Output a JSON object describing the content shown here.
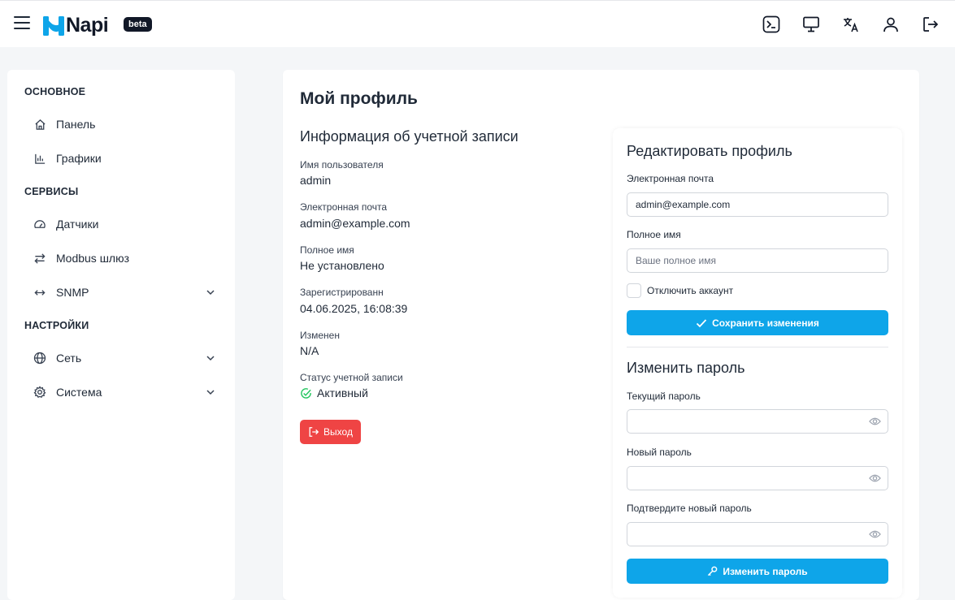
{
  "header": {
    "brand": "Napi",
    "badge": "beta",
    "icons": [
      "terminal-icon",
      "monitor-icon",
      "translate-icon",
      "user-icon",
      "logout-icon"
    ]
  },
  "sidebar": {
    "sections": [
      {
        "title": "ОСНОВНОЕ"
      },
      {
        "title": "СЕРВИСЫ"
      },
      {
        "title": "НАСТРОЙКИ"
      }
    ],
    "items": [
      {
        "label": "Панель",
        "icon": "home-icon"
      },
      {
        "label": "Графики",
        "icon": "bar-chart-icon"
      },
      {
        "label": "Датчики",
        "icon": "gauge-icon"
      },
      {
        "label": "Modbus шлюз",
        "icon": "arrows-exchange-icon"
      },
      {
        "label": "SNMP",
        "icon": "arrows-horizontal-icon"
      },
      {
        "label": "Сеть",
        "icon": "globe-icon"
      },
      {
        "label": "Система",
        "icon": "gear-icon"
      }
    ]
  },
  "main": {
    "title": "Мой профиль",
    "account_info": {
      "title": "Информация об учетной записи",
      "fields": [
        {
          "label": "Имя пользователя",
          "value": "admin"
        },
        {
          "label": "Электронная почта",
          "value": "admin@example.com"
        },
        {
          "label": "Полное имя",
          "value": "Не установлено"
        },
        {
          "label": "Зарегистрированн",
          "value": "04.06.2025, 16:08:39"
        },
        {
          "label": "Изменен",
          "value": "N/A"
        },
        {
          "label": "Статус учетной записи",
          "value": "Активный"
        }
      ],
      "logout_label": "Выход"
    },
    "edit_profile": {
      "title": "Редактировать профиль",
      "email_label": "Электронная почта",
      "email_value": "admin@example.com",
      "fullname_label": "Полное имя",
      "fullname_placeholder": "Ваше полное имя",
      "disable_label": "Отключить аккаунт",
      "save_label": "Сохранить изменения"
    },
    "change_password": {
      "title": "Изменить пароль",
      "current_label": "Текущий пароль",
      "new_label": "Новый пароль",
      "confirm_label": "Подтвердите новый пароль",
      "submit_label": "Изменить пароль"
    }
  },
  "colors": {
    "accent": "#0ea5e9",
    "danger": "#ef4444",
    "success": "#22c55e",
    "logo": "#0ea5e9"
  }
}
